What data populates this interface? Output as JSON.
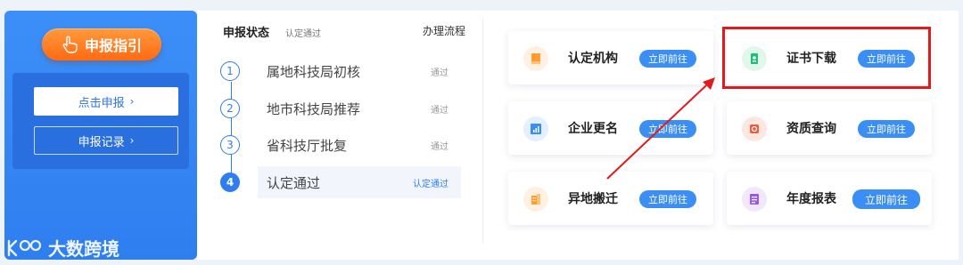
{
  "left": {
    "guide_label": "申报指引",
    "apply_label": "点击申报",
    "record_label": "申报记录",
    "chevron": "›"
  },
  "status": {
    "title": "申报状态",
    "current": "认定通过",
    "process_link": "办理流程",
    "steps": [
      {
        "num": "1",
        "label": "属地科技局初核",
        "result": "通过"
      },
      {
        "num": "2",
        "label": "地市科技局推荐",
        "result": "通过"
      },
      {
        "num": "3",
        "label": "省科技厅批复",
        "result": "通过"
      },
      {
        "num": "4",
        "label": "认定通过",
        "result": "认定通过"
      }
    ]
  },
  "cards": [
    {
      "name": "认定机构",
      "go": "立即前往",
      "icon": "book-icon",
      "color": "#ff9d2e"
    },
    {
      "name": "证书下载",
      "go": "立即前往",
      "icon": "certificate-icon",
      "color": "#1fbf7a"
    },
    {
      "name": "企业更名",
      "go": "立即前往",
      "icon": "chart-icon",
      "color": "#3b8ef3"
    },
    {
      "name": "资质查询",
      "go": "立即前往",
      "icon": "seal-icon",
      "color": "#f05a3a"
    },
    {
      "name": "异地搬迁",
      "go": "立即前往",
      "icon": "building-icon",
      "color": "#ff9d2e"
    },
    {
      "name": "年度报表",
      "go": "立即前往",
      "icon": "report-icon",
      "color": "#9a5ae8"
    }
  ],
  "watermark": {
    "text": "大数跨境"
  },
  "colors": {
    "primary": "#2f7ef0",
    "accent_orange": "#ff7a1a",
    "highlight_red": "#e01b1b"
  }
}
